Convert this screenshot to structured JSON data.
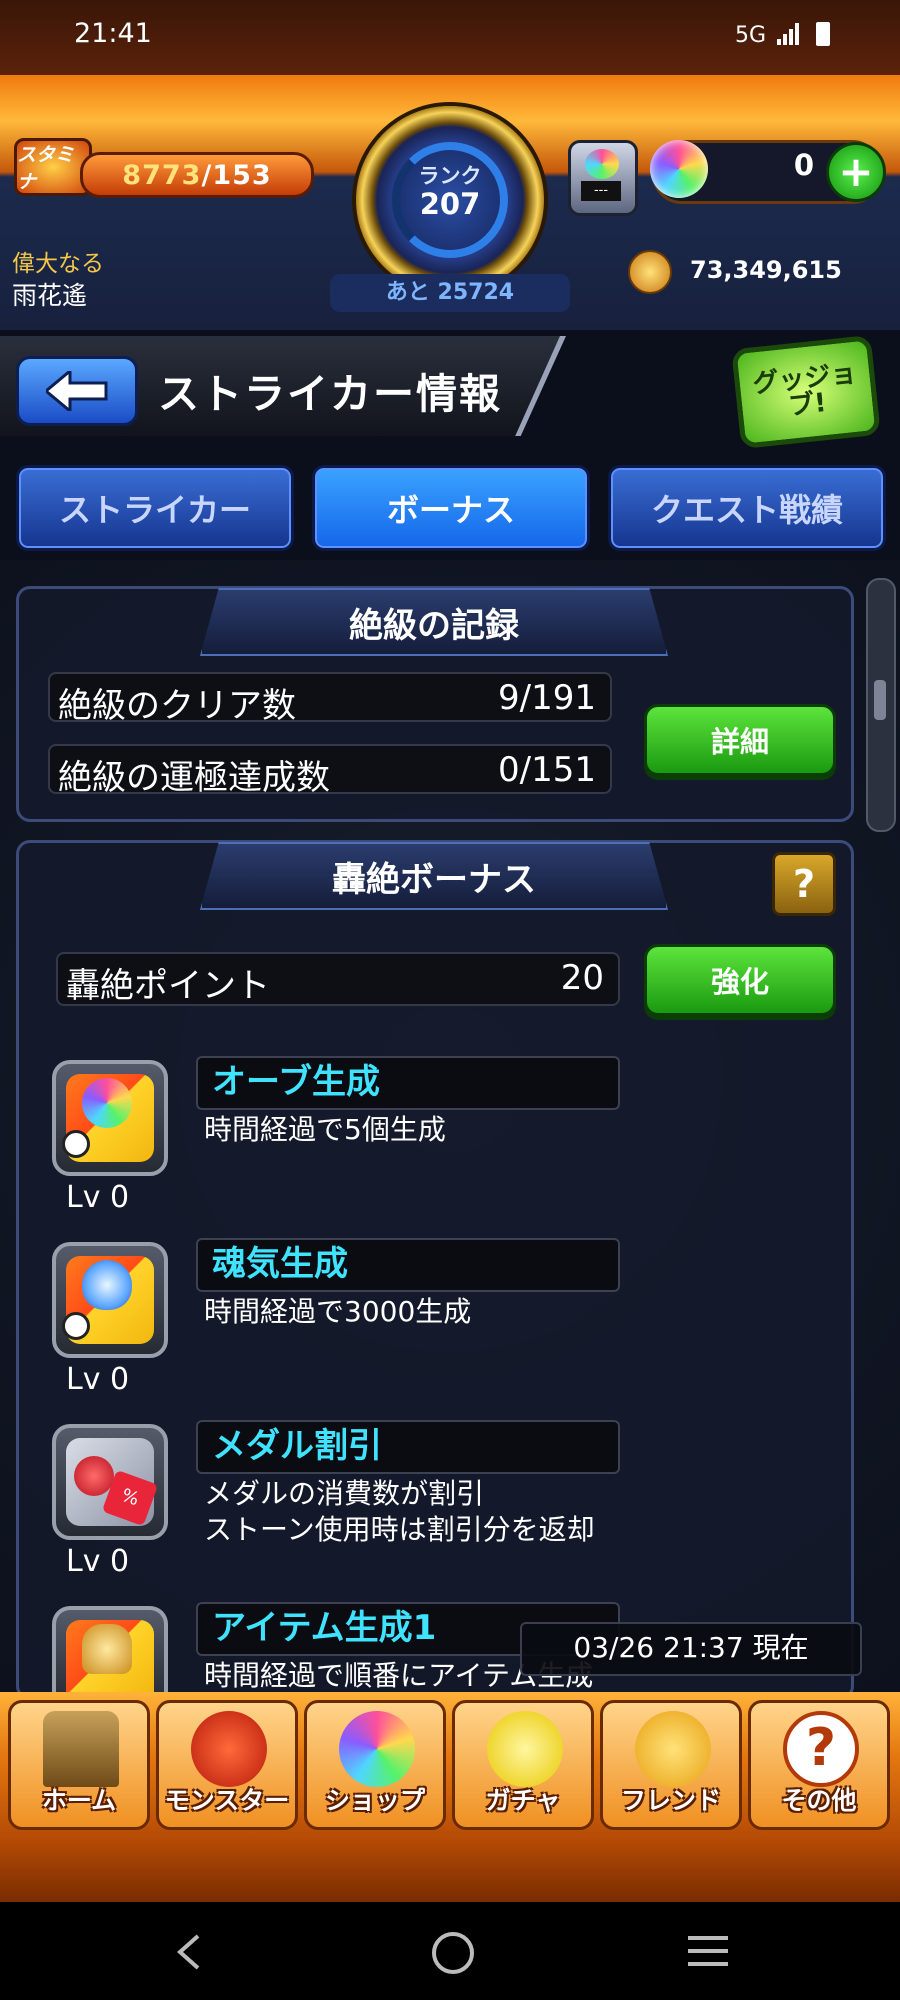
{
  "status_bar": {
    "time": "21:41",
    "network": "5G"
  },
  "header": {
    "stamina_label": "スタミナ",
    "stamina_value": "8773",
    "stamina_max": "/153",
    "rank_label": "ランク",
    "rank_value": "207",
    "rank_next": "あと 25724",
    "lucky_display": "---",
    "orb_count": "0",
    "orb_add": "+",
    "title_line1": "偉大なる",
    "title_line2": "雨花遙",
    "coins": "73,349,615"
  },
  "page": {
    "title": "ストライカー情報",
    "good_job_label": "グッジョブ!"
  },
  "tabs": [
    {
      "label": "ストライカー",
      "active": false
    },
    {
      "label": "ボーナス",
      "active": true
    },
    {
      "label": "クエスト戦績",
      "active": false
    }
  ],
  "record_panel": {
    "heading": "絶級の記録",
    "clear_label": "絶級のクリア数",
    "clear_value": "9/191",
    "luck_label": "絶級の運極達成数",
    "luck_value": "0/151",
    "detail_button": "詳細"
  },
  "bonus_panel": {
    "heading": "轟絶ボーナス",
    "help_label": "?",
    "points_label": "轟絶ポイント",
    "points_value": "20",
    "upgrade_button": "強化",
    "items": [
      {
        "name": "オーブ生成",
        "desc1": "時間経過で5個生成",
        "desc2": "",
        "level": "Lv 0",
        "icon": "orb-generate-icon"
      },
      {
        "name": "魂気生成",
        "desc1": "時間経過で3000生成",
        "desc2": "",
        "level": "Lv 0",
        "icon": "spirit-generate-icon"
      },
      {
        "name": "メダル割引",
        "desc1": "メダルの消費数が割引",
        "desc2": "ストーン使用時は割引分を返却",
        "level": "Lv 0",
        "icon": "medal-discount-icon"
      },
      {
        "name": "アイテム生成1",
        "desc1": "時間経過で順番にアイテム生成",
        "desc2": "",
        "level": "",
        "icon": "item-generate-icon"
      }
    ]
  },
  "timestamp": "03/26 21:37 現在",
  "bottom_nav": [
    {
      "label": "ホーム",
      "icon": "home-icon"
    },
    {
      "label": "モンスター",
      "icon": "monster-icon"
    },
    {
      "label": "ショップ",
      "icon": "shop-icon"
    },
    {
      "label": "ガチャ",
      "icon": "gacha-icon"
    },
    {
      "label": "フレンド",
      "icon": "friend-icon"
    },
    {
      "label": "その他",
      "icon": "other-icon"
    }
  ],
  "colors": {
    "accent_blue": "#1566ea",
    "green_button": "#1a9a10",
    "item_name_cyan": "#3fe3ff",
    "header_orange": "#f07a0e"
  }
}
